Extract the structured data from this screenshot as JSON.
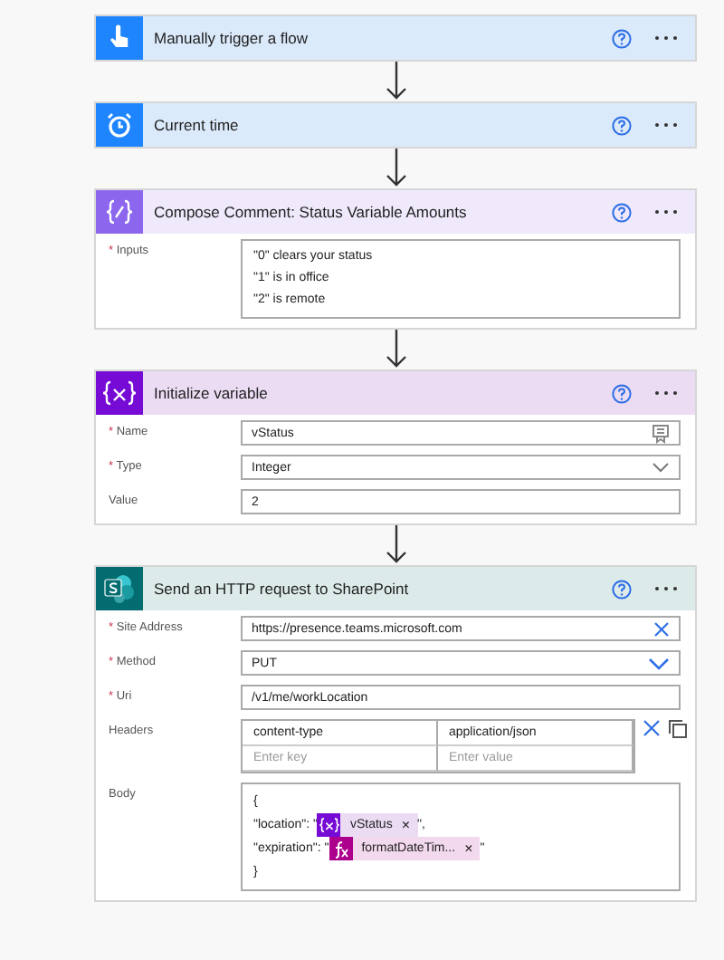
{
  "cards": [
    {
      "kind": "trigger",
      "color": "#1f85ff",
      "title": "Manually trigger a flow"
    },
    {
      "kind": "time",
      "color": "#1f85ff",
      "title": "Current time"
    },
    {
      "kind": "compose",
      "color": "#8c67ee",
      "title": "Compose Comment: Status Variable Amounts",
      "fields": [
        {
          "kind": "multiline",
          "mark": "*",
          "label": "Inputs",
          "lines": [
            "\"0\" clears your status",
            "\"1\" is in office",
            "\"2\" is remote"
          ]
        }
      ]
    },
    {
      "kind": "variable",
      "color": "#770bd6",
      "title": "Initialize variable",
      "fields": [
        {
          "kind": "text-picker",
          "mark": "*",
          "label": "Name",
          "value": "vStatus"
        },
        {
          "kind": "dropdown",
          "mark": "*",
          "label": "Type",
          "value": "Integer"
        },
        {
          "kind": "text",
          "label": "Value",
          "value": "2"
        }
      ]
    },
    {
      "kind": "sharepoint",
      "color": "#036c70",
      "title": "Send an HTTP request to SharePoint",
      "fields": [
        {
          "kind": "text-clear",
          "mark": "*",
          "label": "Site Address",
          "value": "https://presence.teams.microsoft.com"
        },
        {
          "kind": "dropdown-accent",
          "mark": "*",
          "label": "Method",
          "value": "PUT"
        },
        {
          "kind": "text",
          "mark": "*",
          "label": "Uri",
          "value": "/v1/me/workLocation"
        },
        {
          "kind": "headers",
          "label": "Headers",
          "rows": [
            {
              "key": "content-type",
              "value": "application/json"
            },
            {
              "key_placeholder": "Enter key",
              "value_placeholder": "Enter value"
            }
          ]
        },
        {
          "kind": "body",
          "label": "Body",
          "lines": [
            [
              {
                "kind": "text",
                "text": "{"
              }
            ],
            [
              {
                "kind": "text",
                "text": "\"location\": \""
              },
              {
                "kind": "variable-token",
                "color": "#770bd6",
                "text": "vStatus",
                "remove": "×"
              },
              {
                "kind": "text",
                "text": "\","
              }
            ],
            [
              {
                "kind": "text",
                "text": "\"expiration\": \""
              },
              {
                "kind": "function-token",
                "color": "#ad008c",
                "text": "formatDateTim...",
                "remove": "×"
              },
              {
                "kind": "text",
                "text": "\""
              }
            ],
            [
              {
                "kind": "text",
                "text": "}"
              }
            ]
          ]
        }
      ]
    }
  ]
}
